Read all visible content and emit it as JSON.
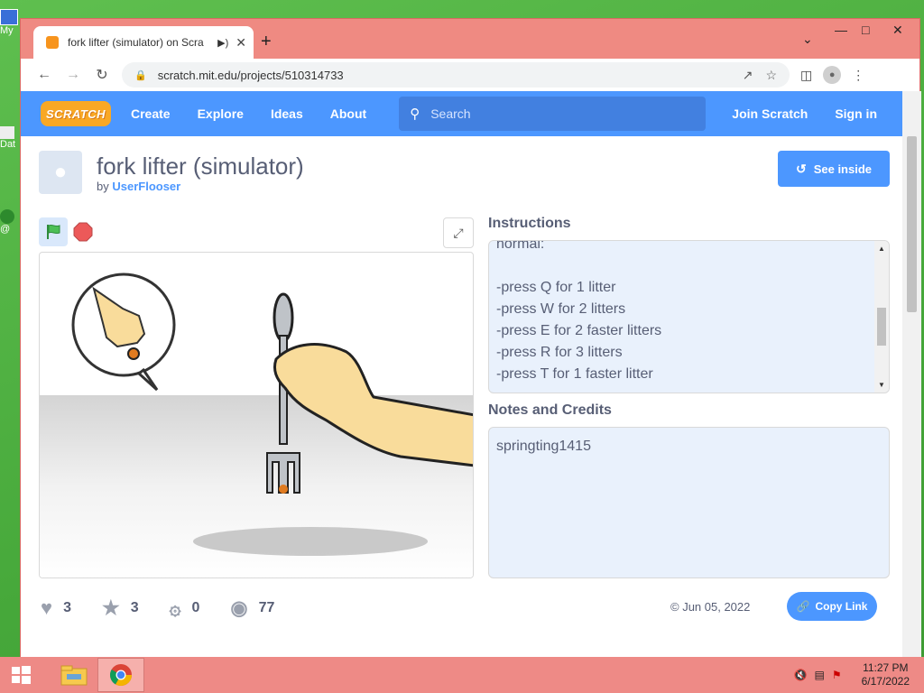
{
  "desktop": {
    "icons": [
      {
        "label": "My"
      },
      {
        "label": "Dat"
      },
      {
        "label": "@"
      }
    ]
  },
  "browser": {
    "tab": {
      "title": "fork lifter (simulator) on Scra",
      "audio_icon": "speaker-icon"
    },
    "address": {
      "url": "scratch.mit.edu/projects/510314733"
    }
  },
  "scratch": {
    "nav": {
      "logo": "SCRATCH",
      "links": [
        "Create",
        "Explore",
        "Ideas",
        "About"
      ],
      "search_placeholder": "Search",
      "join": "Join Scratch",
      "signin": "Sign in"
    },
    "project": {
      "title": "fork lifter (simulator)",
      "by_prefix": "by",
      "author": "UserFlooser",
      "see_inside": "See inside"
    },
    "instructions": {
      "heading": "Instructions",
      "lines": [
        "normal:",
        "",
        "-press Q for 1 litter",
        "-press W for 2 litters",
        "-press E for 2 faster litters",
        "-press R for 3 litters",
        "-press T for 1 faster litter"
      ]
    },
    "notes": {
      "heading": "Notes and Credits",
      "text": "springting1415"
    },
    "stats": {
      "loves": "3",
      "favorites": "3",
      "remixes": "0",
      "views": "77"
    },
    "date": "© Jun 05, 2022",
    "copy_link": "Copy Link"
  },
  "taskbar": {
    "time": "11:27 PM",
    "date": "6/17/2022"
  },
  "colors": {
    "scratch_blue": "#4c97ff",
    "window_frame": "#ef8a82",
    "text": "#575e75"
  }
}
